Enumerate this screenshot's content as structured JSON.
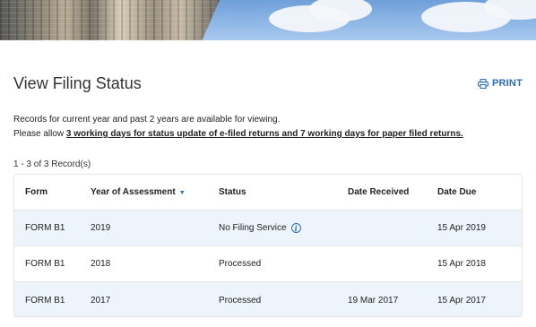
{
  "page": {
    "title": "View Filing Status",
    "print_label": "PRINT",
    "note_line1": "Records for current year and past 2 years are available for viewing.",
    "note_line2_prefix": "Please allow ",
    "note_line2_emphasis": "3 working days for status update of e-filed returns and 7 working days for paper filed returns.",
    "record_count": "1 - 3 of 3 Record(s)"
  },
  "icons": {
    "print": "printer-icon",
    "info": "info-icon",
    "sort": "sort-down-icon"
  },
  "colors": {
    "link": "#2a6ebb",
    "row_highlight": "#eef4fb",
    "border": "#e3e6ea"
  },
  "table": {
    "columns": [
      "Form",
      "Year of Assessment",
      "Status",
      "Date Received",
      "Date Due"
    ],
    "sort_indicator": "▼",
    "rows": [
      {
        "form": "FORM B1",
        "year": "2019",
        "status": "No Filing Service",
        "received": "",
        "due": "15 Apr 2019",
        "info": "i"
      },
      {
        "form": "FORM B1",
        "year": "2018",
        "status": "Processed",
        "received": "",
        "due": "15 Apr 2018"
      },
      {
        "form": "FORM B1",
        "year": "2017",
        "status": "Processed",
        "received": "19 Mar 2017",
        "due": "15 Apr 2017"
      }
    ]
  }
}
